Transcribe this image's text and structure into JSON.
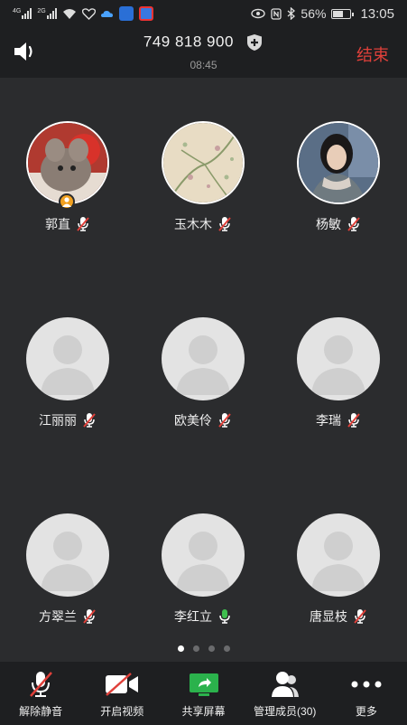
{
  "status_bar": {
    "signal1_tag": "4G",
    "signal2_tag": "2G",
    "battery": "56%",
    "time": "13:05"
  },
  "header": {
    "meeting_id": "749 818 900",
    "duration": "08:45",
    "end_label": "结束"
  },
  "participants": [
    {
      "name": "郭直",
      "avatar": "photo-chinchilla",
      "muted": true,
      "host": true
    },
    {
      "name": "玉木木",
      "avatar": "photo-floral",
      "muted": true,
      "host": false
    },
    {
      "name": "杨敏",
      "avatar": "photo-woman",
      "muted": true,
      "host": false
    },
    {
      "name": "江丽丽",
      "avatar": "default",
      "muted": true,
      "host": false
    },
    {
      "name": "欧美伶",
      "avatar": "default",
      "muted": true,
      "host": false
    },
    {
      "name": "李瑞",
      "avatar": "default",
      "muted": true,
      "host": false
    },
    {
      "name": "方翠兰",
      "avatar": "default",
      "muted": true,
      "host": false
    },
    {
      "name": "李红立",
      "avatar": "default",
      "muted": false,
      "host": false
    },
    {
      "name": "唐显枝",
      "avatar": "default",
      "muted": true,
      "host": false
    }
  ],
  "pagination": {
    "pages": 4,
    "current": 1
  },
  "toolbar": {
    "unmute": "解除静音",
    "start_video": "开启视频",
    "share_screen": "共享屏幕",
    "manage_members": "管理成员(30)",
    "more": "更多"
  },
  "colors": {
    "background": "#2b2c2e",
    "bar": "#1e1f21",
    "end": "#e0403a",
    "muted_mic": "#e0403a",
    "active_mic": "#3fbf4f",
    "share_green": "#2bb24c",
    "host_badge": "#f0a020"
  }
}
